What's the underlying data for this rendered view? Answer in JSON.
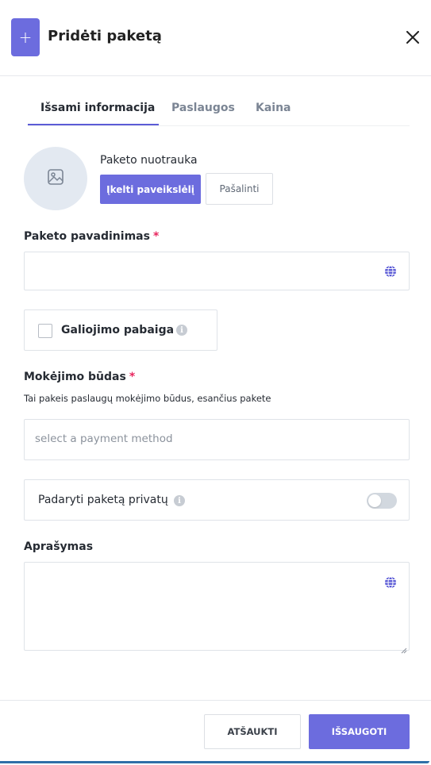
{
  "header": {
    "plus_glyph": "+",
    "title": "Pridėti paketą",
    "close_icon": "close-icon"
  },
  "tabs": [
    {
      "label": "Išsami informacija",
      "active": true
    },
    {
      "label": "Paslaugos",
      "active": false
    },
    {
      "label": "Kaina",
      "active": false
    }
  ],
  "photo": {
    "label": "Paketo nuotrauka",
    "upload_label": "Įkelti paveikslėlį",
    "remove_label": "Pašalinti",
    "placeholder_icon": "image-icon"
  },
  "name_field": {
    "label": "Paketo pavadinimas",
    "required_mark": "*",
    "value": "",
    "icon": "globe-icon"
  },
  "expiry": {
    "label": "Galiojimo pabaiga",
    "checked": false,
    "info_icon": "info-icon"
  },
  "payment": {
    "label": "Mokėjimo būdas",
    "required_mark": "*",
    "hint": "Tai pakeis paslaugų mokėjimo būdus, esančius pakete",
    "placeholder": "select a payment method"
  },
  "private": {
    "label": "Padaryti paketą privatų",
    "enabled": false,
    "info_icon": "info-icon"
  },
  "description": {
    "label": "Aprašymas",
    "value": "",
    "icon": "globe-icon"
  },
  "footer": {
    "cancel_label": "ATŠAUKTI",
    "save_label": "IŠSAUGOTI"
  },
  "colors": {
    "accent": "#6c6cde",
    "required": "#e8265e"
  }
}
